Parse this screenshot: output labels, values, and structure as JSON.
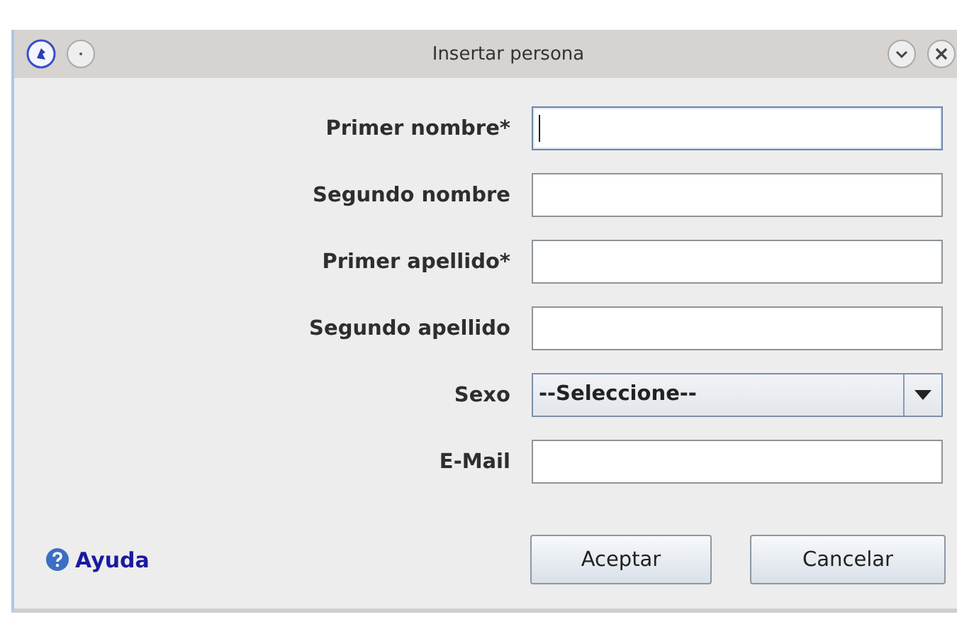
{
  "window": {
    "title": "Insertar persona"
  },
  "fields": [
    {
      "kind": "text",
      "label": "Primer nombre*",
      "focused": true
    },
    {
      "kind": "text",
      "label": "Segundo nombre",
      "focused": false
    },
    {
      "kind": "text",
      "label": "Primer apellido*",
      "focused": false
    },
    {
      "kind": "text",
      "label": "Segundo apellido",
      "focused": false
    },
    {
      "kind": "select",
      "label": "Sexo",
      "value": "--Seleccione--"
    },
    {
      "kind": "text",
      "label": "E-Mail",
      "focused": false
    }
  ],
  "help_link": "Ayuda",
  "buttons": [
    "Aceptar",
    "Cancelar"
  ]
}
